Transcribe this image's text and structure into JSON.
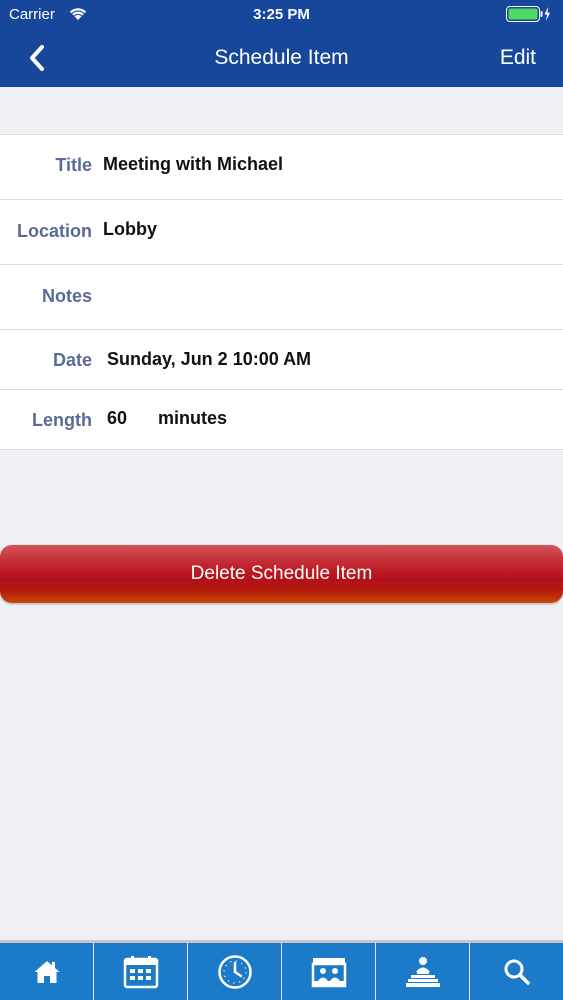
{
  "status": {
    "carrier": "Carrier",
    "time": "3:25 PM"
  },
  "nav": {
    "title": "Schedule Item",
    "edit_label": "Edit"
  },
  "fields": {
    "title": {
      "label": "Title",
      "value": "Meeting with Michael"
    },
    "location": {
      "label": "Location",
      "value": "Lobby"
    },
    "notes": {
      "label": "Notes",
      "value": ""
    },
    "date": {
      "label": "Date",
      "value": "Sunday, Jun 2 10:00 AM"
    },
    "length": {
      "label": "Length",
      "value": "60",
      "unit": "minutes"
    }
  },
  "delete_label": "Delete Schedule Item",
  "tabs": [
    {
      "icon": "home-icon"
    },
    {
      "icon": "calendar-icon"
    },
    {
      "icon": "clock-icon"
    },
    {
      "icon": "exhibitor-booth-icon"
    },
    {
      "icon": "speaker-podium-icon"
    },
    {
      "icon": "search-icon"
    }
  ],
  "colors": {
    "nav_bg": "#16479a",
    "tabbar_bg": "#1b7bc8",
    "label": "#5a6b96",
    "delete_red": "#b3101a"
  }
}
